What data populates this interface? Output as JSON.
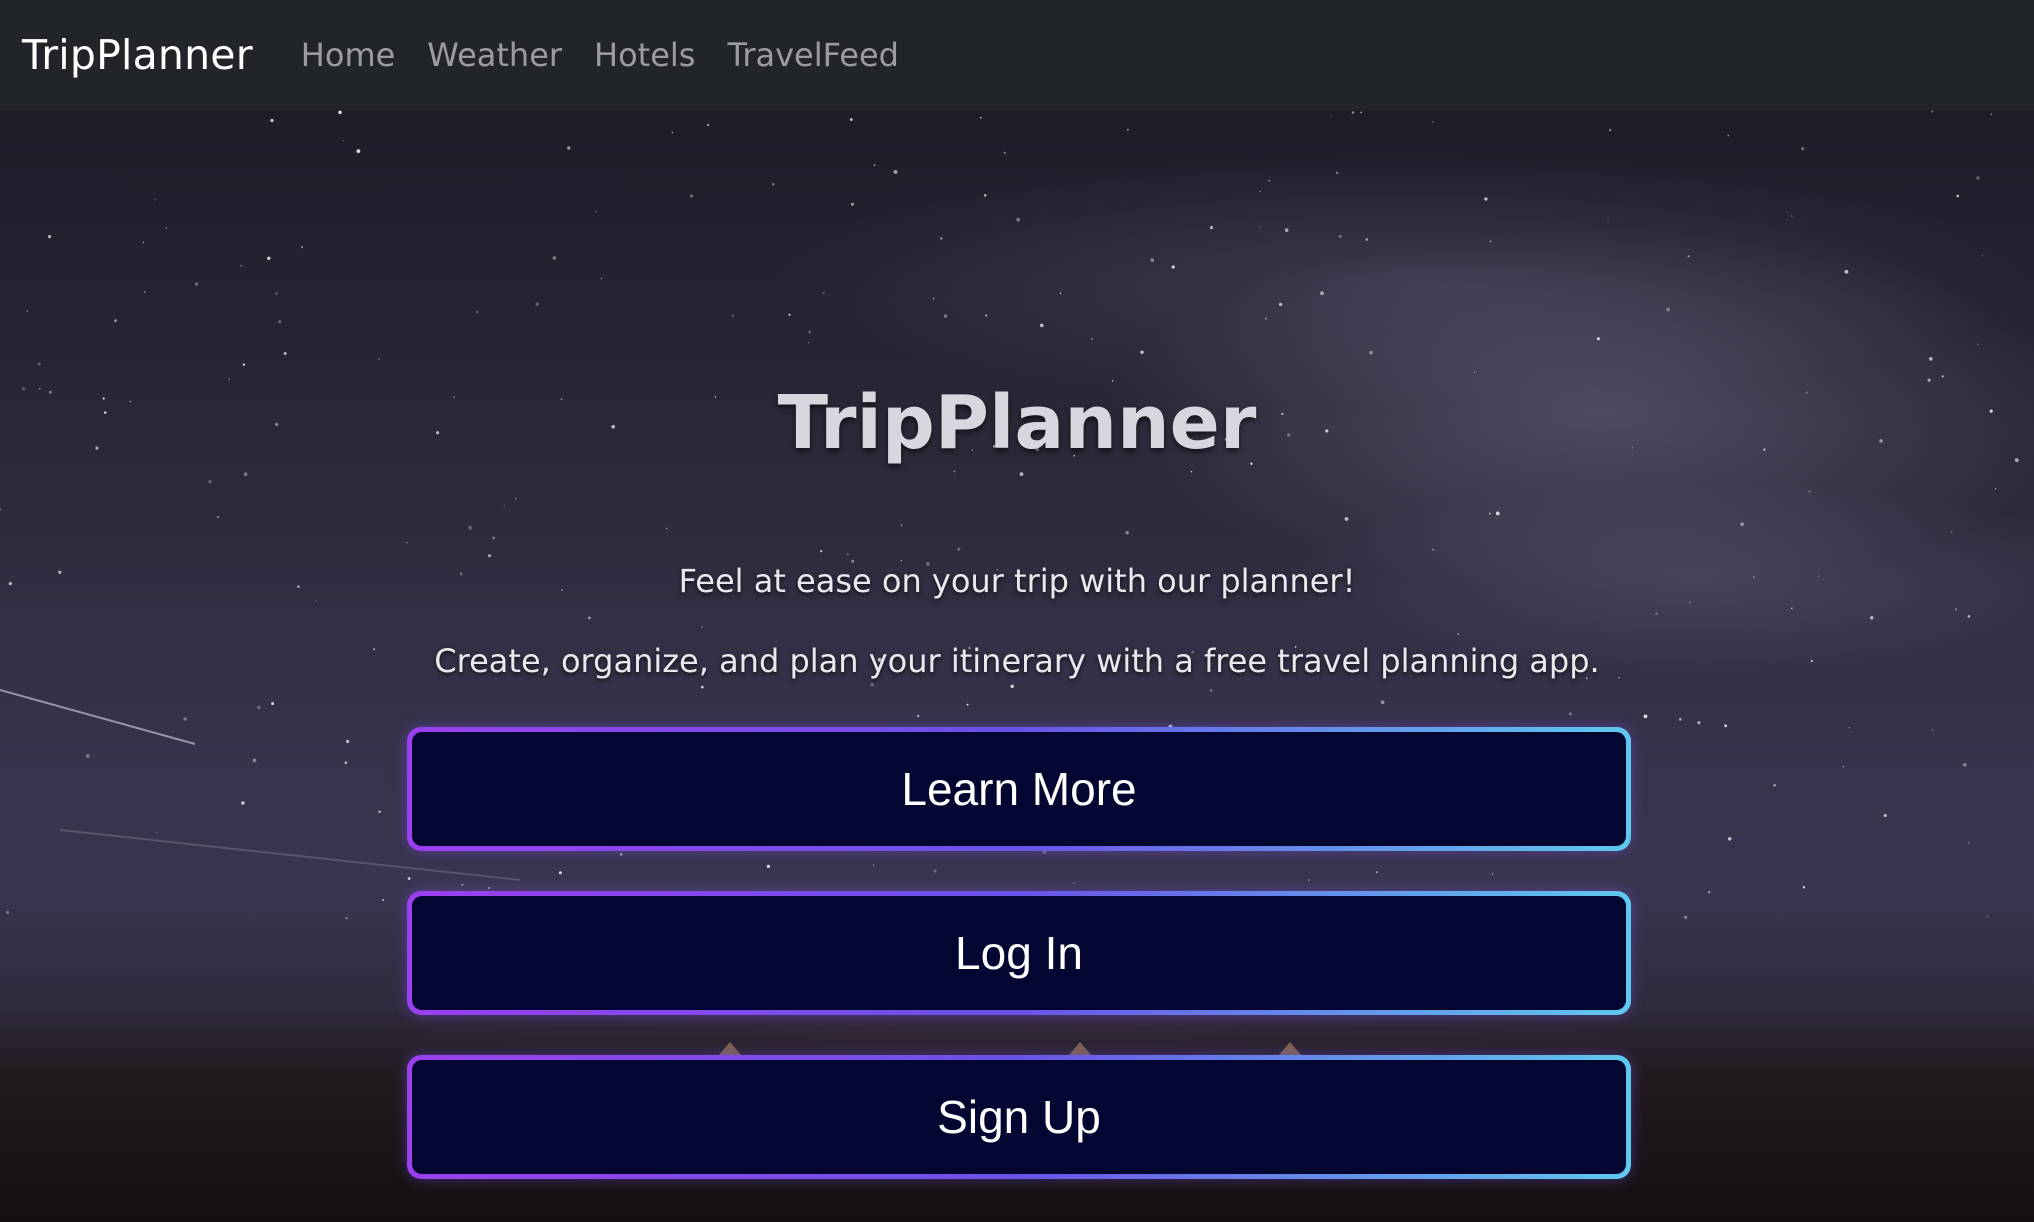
{
  "navbar": {
    "brand": "TripPlanner",
    "links": [
      {
        "label": "Home"
      },
      {
        "label": "Weather"
      },
      {
        "label": "Hotels"
      },
      {
        "label": "TravelFeed"
      }
    ]
  },
  "hero": {
    "title": "TripPlanner",
    "tagline_1": "Feel at ease on your trip with our planner!",
    "tagline_2": "Create, organize, and plan your itinerary with a free travel planning app.",
    "background": "night-sky-campsite-photo"
  },
  "buttons": {
    "learn_more": "Learn More",
    "log_in": "Log In",
    "sign_up": "Sign Up"
  },
  "colors": {
    "navbar_bg": "#212529",
    "button_fill": "#020631",
    "button_border_start": "#9b3ff0",
    "button_border_end": "#5fc8ee"
  }
}
